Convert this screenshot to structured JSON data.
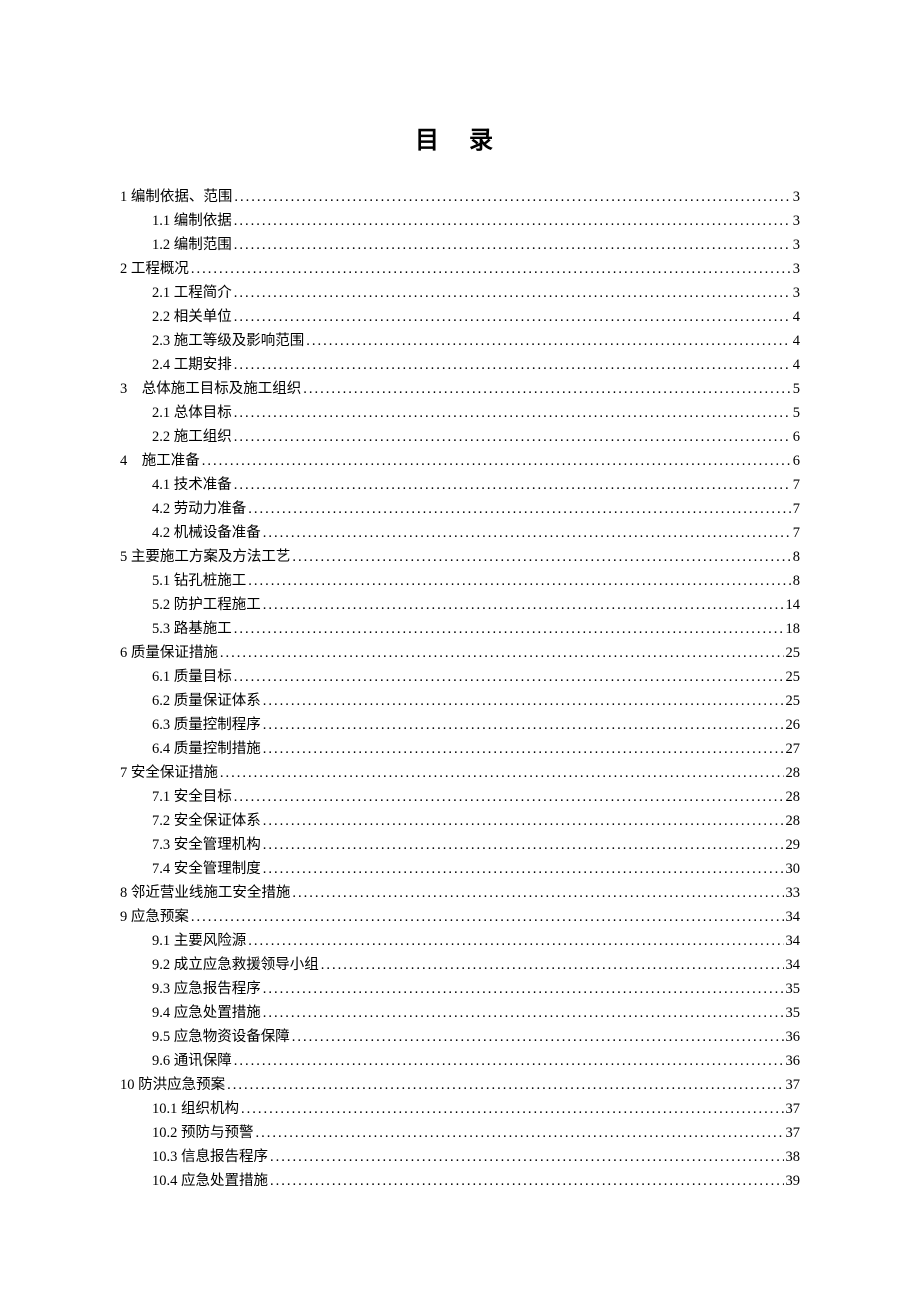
{
  "title": "目 录",
  "toc": [
    {
      "level": 1,
      "label": "1 编制依据、范围",
      "page": "3"
    },
    {
      "level": 2,
      "label": "1.1 编制依据",
      "page": "3"
    },
    {
      "level": 2,
      "label": "1.2 编制范围",
      "page": "3"
    },
    {
      "level": 1,
      "label": "2 工程概况",
      "page": "3"
    },
    {
      "level": 2,
      "label": "2.1 工程简介",
      "page": "3"
    },
    {
      "level": 2,
      "label": "2.2 相关单位",
      "page": "4"
    },
    {
      "level": 2,
      "label": "2.3 施工等级及影响范围",
      "page": "4"
    },
    {
      "level": 2,
      "label": "2.4 工期安排",
      "page": "4"
    },
    {
      "level": 1,
      "label": "3　总体施工目标及施工组织",
      "page": "5"
    },
    {
      "level": 2,
      "label": "2.1 总体目标",
      "page": "5"
    },
    {
      "level": 2,
      "label": "2.2 施工组织",
      "page": "6"
    },
    {
      "level": 1,
      "label": "4　施工准备",
      "page": "6"
    },
    {
      "level": 2,
      "label": "4.1 技术准备",
      "page": "7"
    },
    {
      "level": 2,
      "label": "4.2 劳动力准备",
      "page": "7"
    },
    {
      "level": 2,
      "label": "4.2 机械设备准备",
      "page": "7"
    },
    {
      "level": 1,
      "label": "5 主要施工方案及方法工艺",
      "page": "8"
    },
    {
      "level": 2,
      "label": "5.1 钻孔桩施工",
      "page": "8"
    },
    {
      "level": 2,
      "label": "5.2 防护工程施工",
      "page": "14"
    },
    {
      "level": 2,
      "label": "5.3 路基施工",
      "page": "18"
    },
    {
      "level": 1,
      "label": "6 质量保证措施",
      "page": "25"
    },
    {
      "level": 2,
      "label": "6.1 质量目标",
      "page": "25"
    },
    {
      "level": 2,
      "label": "6.2 质量保证体系",
      "page": "25"
    },
    {
      "level": 2,
      "label": "6.3 质量控制程序",
      "page": "26"
    },
    {
      "level": 2,
      "label": "6.4 质量控制措施",
      "page": "27"
    },
    {
      "level": 1,
      "label": "7 安全保证措施",
      "page": "28"
    },
    {
      "level": 2,
      "label": "7.1 安全目标",
      "page": "28"
    },
    {
      "level": 2,
      "label": "7.2 安全保证体系",
      "page": "28"
    },
    {
      "level": 2,
      "label": "7.3 安全管理机构",
      "page": "29"
    },
    {
      "level": 2,
      "label": "7.4 安全管理制度",
      "page": "30"
    },
    {
      "level": 1,
      "label": "8 邻近营业线施工安全措施",
      "page": "33"
    },
    {
      "level": 1,
      "label": "9 应急预案",
      "page": "34"
    },
    {
      "level": 2,
      "label": "9.1 主要风险源",
      "page": "34"
    },
    {
      "level": 2,
      "label": "9.2 成立应急救援领导小组",
      "page": "34"
    },
    {
      "level": 2,
      "label": "9.3 应急报告程序",
      "page": "35"
    },
    {
      "level": 2,
      "label": "9.4 应急处置措施",
      "page": "35"
    },
    {
      "level": 2,
      "label": "9.5 应急物资设备保障",
      "page": "36"
    },
    {
      "level": 2,
      "label": "9.6 通讯保障",
      "page": "36"
    },
    {
      "level": 1,
      "label": "10 防洪应急预案",
      "page": "37"
    },
    {
      "level": 2,
      "label": "10.1 组织机构",
      "page": "37"
    },
    {
      "level": 2,
      "label": "10.2 预防与预警",
      "page": "37"
    },
    {
      "level": 2,
      "label": "10.3 信息报告程序",
      "page": "38"
    },
    {
      "level": 2,
      "label": "10.4 应急处置措施",
      "page": "39"
    }
  ]
}
